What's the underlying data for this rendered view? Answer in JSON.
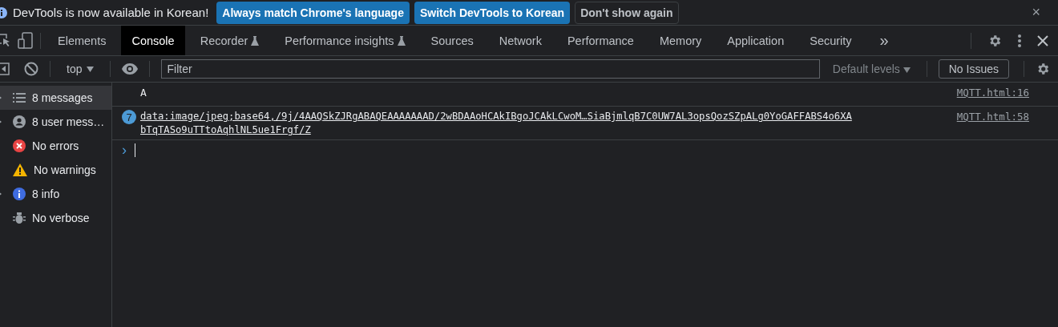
{
  "infobar": {
    "message": "DevTools is now available in Korean!",
    "buttons": [
      {
        "label": "Always match Chrome's language",
        "kind": "primary"
      },
      {
        "label": "Switch DevTools to Korean",
        "kind": "primary"
      },
      {
        "label": "Don't show again",
        "kind": "secondary"
      }
    ],
    "close": "×"
  },
  "tabs": [
    {
      "label": "Elements",
      "selected": false,
      "experimental": false
    },
    {
      "label": "Console",
      "selected": true,
      "experimental": false
    },
    {
      "label": "Recorder",
      "selected": false,
      "experimental": true
    },
    {
      "label": "Performance insights",
      "selected": false,
      "experimental": true
    },
    {
      "label": "Sources",
      "selected": false,
      "experimental": false
    },
    {
      "label": "Network",
      "selected": false,
      "experimental": false
    },
    {
      "label": "Performance",
      "selected": false,
      "experimental": false
    },
    {
      "label": "Memory",
      "selected": false,
      "experimental": false
    },
    {
      "label": "Application",
      "selected": false,
      "experimental": false
    },
    {
      "label": "Security",
      "selected": false,
      "experimental": false
    }
  ],
  "more_tabs": "»",
  "toolbar": {
    "context": "top",
    "filter_placeholder": "Filter",
    "levels": "Default levels",
    "issues": "No Issues"
  },
  "sidebar": {
    "items": [
      {
        "label": "8 messages",
        "kind": "list",
        "expandable": true,
        "selected": true
      },
      {
        "label": "8 user mess…",
        "kind": "user",
        "expandable": true,
        "selected": false
      },
      {
        "label": "No errors",
        "kind": "error",
        "expandable": false,
        "selected": false
      },
      {
        "label": "No warnings",
        "kind": "warning",
        "expandable": false,
        "selected": false
      },
      {
        "label": "8 info",
        "kind": "info",
        "expandable": true,
        "selected": false
      },
      {
        "label": "No verbose",
        "kind": "verbose",
        "expandable": false,
        "selected": false
      }
    ]
  },
  "console": {
    "messages": [
      {
        "lines": [
          "A"
        ],
        "link": false,
        "source": "MQTT.html:16"
      },
      {
        "count": "7",
        "lines": [
          "data:image/jpeg;base64,/9j/4AAQSkZJRgABAQEAAAAAAAD/2wBDAAoHCAkIBgoJCAkLCwoM…SiaBjmlqB7C0UW7AL3opsQozSZpALg0YoGAFFABS4o6XA",
          "bTqTASo9uTTtoAqhlNL5ue1Frgf/Z"
        ],
        "link": true,
        "source": "MQTT.html:58"
      }
    ],
    "prompt": "›"
  }
}
